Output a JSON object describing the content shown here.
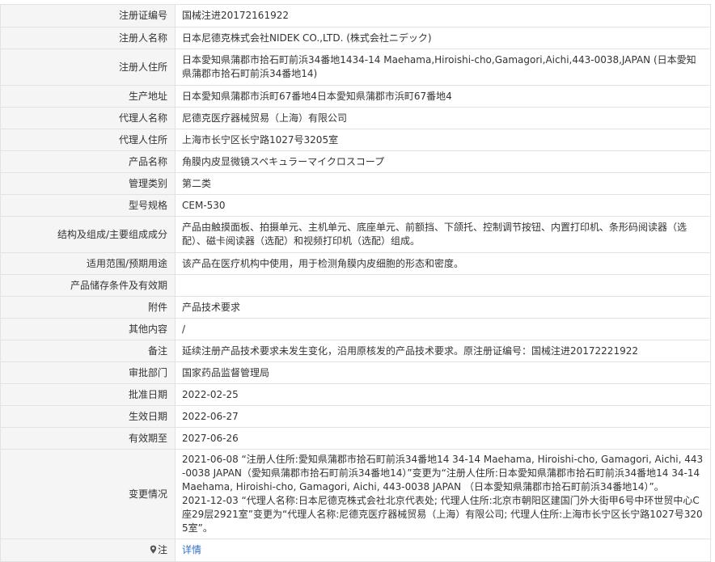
{
  "rows": [
    {
      "label": "注册证编号",
      "value": "国械注进20172161922"
    },
    {
      "label": "注册人名称",
      "value": "日本尼德克株式会社NIDEK CO.,LTD. (株式会社ニデック)"
    },
    {
      "label": "注册人住所",
      "value": "日本愛知県蒲郡市拾石町前浜34番地1434-14 Maehama,Hiroishi-cho,Gamagori,Aichi,443-0038,JAPAN (日本愛知県蒲郡市拾石町前浜34番地14)"
    },
    {
      "label": "生产地址",
      "value": "日本愛知県蒲郡市浜町67番地4日本愛知県蒲郡市浜町67番地4"
    },
    {
      "label": "代理人名称",
      "value": "尼德克医疗器械贸易（上海）有限公司"
    },
    {
      "label": "代理人住所",
      "value": "上海市长宁区长宁路1027号3205室"
    },
    {
      "label": "产品名称",
      "value": "角膜内皮显微镜スペキュラーマイクロスコープ"
    },
    {
      "label": "管理类别",
      "value": "第二类"
    },
    {
      "label": "型号规格",
      "value": "CEM-530"
    },
    {
      "label": "结构及组成/主要组成成分",
      "value": "产品由触摸面板、拍摄单元、主机单元、底座单元、前额挡、下颌托、控制调节按钮、内置打印机、条形码阅读器（选配）、磁卡阅读器（选配）和视频打印机（选配）组成。"
    },
    {
      "label": "适用范围/预期用途",
      "value": "该产品在医疗机构中使用，用于检测角膜内皮细胞的形态和密度。"
    },
    {
      "label": "产品储存条件及有效期",
      "value": ""
    },
    {
      "label": "附件",
      "value": "产品技术要求"
    },
    {
      "label": "其他内容",
      "value": "/"
    },
    {
      "label": "备注",
      "value": "延续注册产品技术要求未发生变化，沿用原核发的产品技术要求。原注册证编号：国械注进20172221922"
    },
    {
      "label": "审批部门",
      "value": "国家药品监督管理局"
    },
    {
      "label": "批准日期",
      "value": "2022-02-25"
    },
    {
      "label": "生效日期",
      "value": "2022-06-27"
    },
    {
      "label": "有效期至",
      "value": "2027-06-26"
    }
  ],
  "changes": {
    "label": "变更情况",
    "entries": [
      "2021-06-08 “注册人住所:愛知県蒲郡市拾石町前浜34番地14 34-14 Maehama, Hiroishi-cho, Gamagori, Aichi, 443-0038 JAPAN（愛知県蒲郡市拾石町前浜34番地14）”变更为“注册人住所:日本愛知県蒲郡市拾石町前浜34番地14 34-14 Maehama, Hiroishi-cho, Gamagori, Aichi, 443-0038 JAPAN （日本愛知県蒲郡市拾石町前浜34番地14）”。",
      "2021-12-03 “代理人名称:日本尼德克株式会社北京代表处; 代理人住所:北京市朝阳区建国门外大街甲6号中环世贸中心C座29层2921室”变更为“代理人名称:尼德克医疗器械贸易（上海）有限公司; 代理人住所:上海市长宁区长宁路1027号3205室”。"
    ]
  },
  "note": {
    "label": "注",
    "link_text": "详情",
    "pin_icon": "map-pin-icon",
    "link_color": "#3170c7"
  }
}
